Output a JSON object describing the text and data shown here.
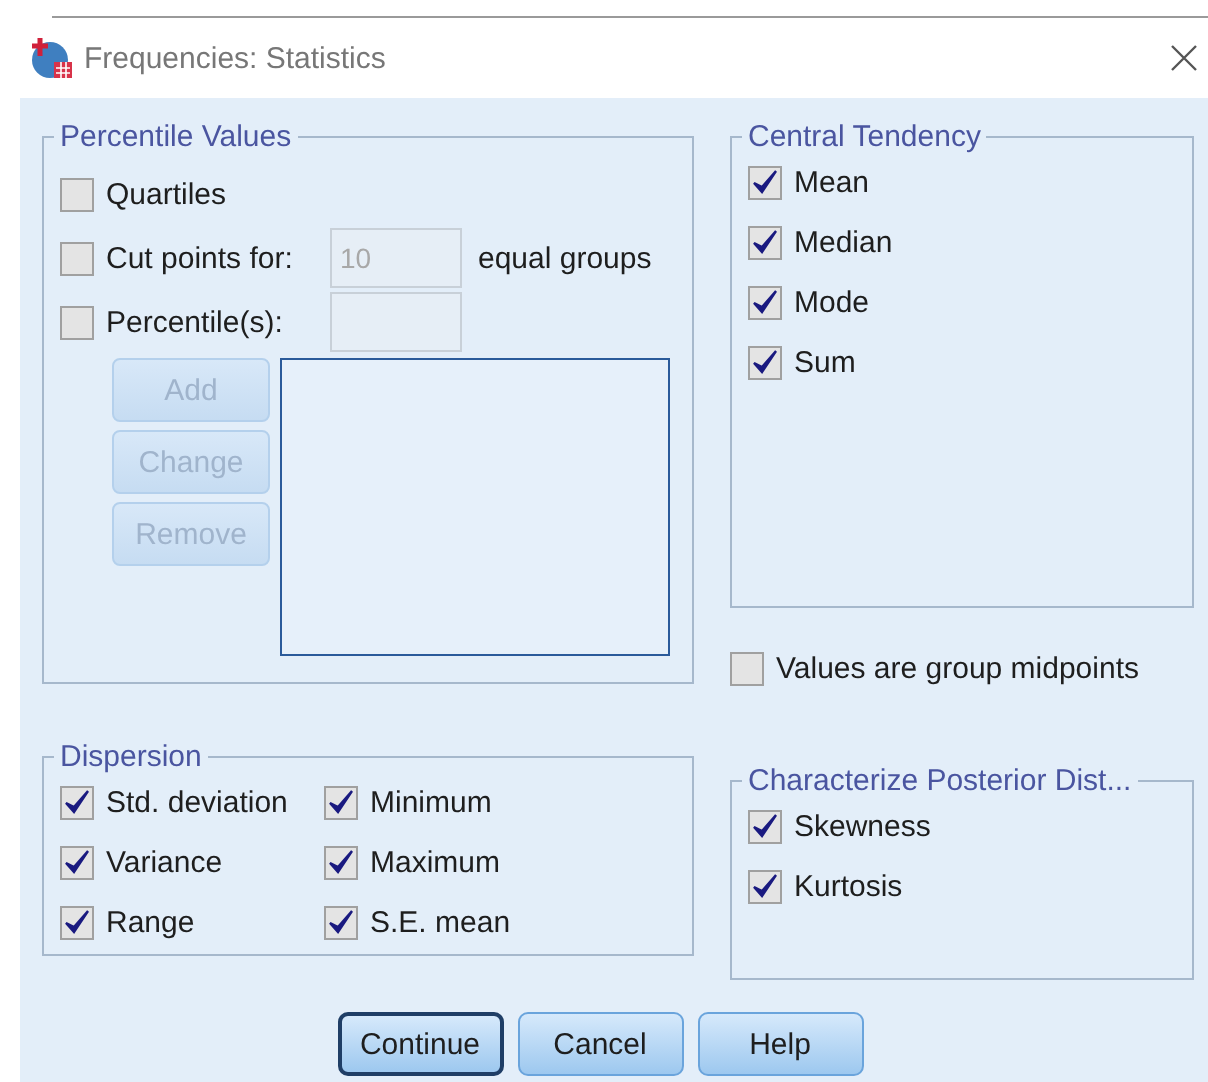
{
  "window": {
    "title": "Frequencies: Statistics"
  },
  "percentile_values": {
    "title": "Percentile Values",
    "options": [
      {
        "kind": "plain",
        "label": "Quartiles",
        "checked": false
      },
      {
        "kind": "field",
        "label": "Cut points for:",
        "checked": false,
        "value": "10",
        "suffix": "equal groups",
        "disabled": true
      },
      {
        "kind": "field",
        "label": "Percentile(s):",
        "checked": false,
        "disabled": true
      }
    ],
    "buttons": [
      {
        "label": "Add",
        "disabled": true
      },
      {
        "label": "Change",
        "disabled": true
      },
      {
        "label": "Remove",
        "disabled": true
      }
    ]
  },
  "central_tendency": {
    "title": "Central Tendency",
    "options": [
      {
        "label": "Mean",
        "checked": true
      },
      {
        "label": "Median",
        "checked": true
      },
      {
        "label": "Mode",
        "checked": true
      },
      {
        "label": "Sum",
        "checked": true
      }
    ]
  },
  "group_midpoints": {
    "label": "Values are group midpoints",
    "checked": false
  },
  "dispersion": {
    "title": "Dispersion",
    "options": [
      {
        "label": "Std. deviation",
        "checked": true
      },
      {
        "label": "Minimum",
        "checked": true
      },
      {
        "label": "Variance",
        "checked": true
      },
      {
        "label": "Maximum",
        "checked": true
      },
      {
        "label": "Range",
        "checked": true
      },
      {
        "label": "S.E. mean",
        "checked": true
      }
    ]
  },
  "posterior": {
    "title": "Characterize Posterior Dist...",
    "options": [
      {
        "label": "Skewness",
        "checked": true
      },
      {
        "label": "Kurtosis",
        "checked": true
      }
    ]
  },
  "buttons": [
    {
      "label": "Continue",
      "default": true
    },
    {
      "label": "Cancel",
      "default": false
    },
    {
      "label": "Help",
      "default": false
    }
  ]
}
